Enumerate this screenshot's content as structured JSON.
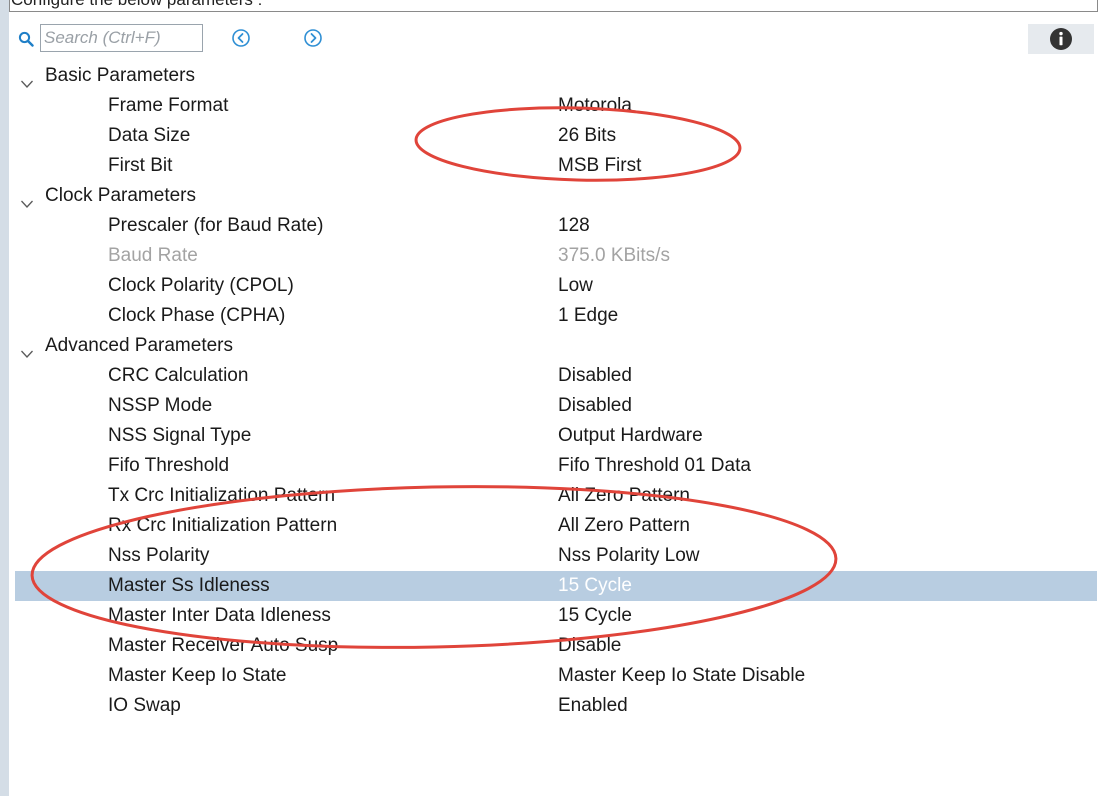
{
  "header": {
    "text": "Configure the below parameters :"
  },
  "toolbar": {
    "search_placeholder": "Search (Ctrl+F)",
    "search_icon": "search-icon",
    "prev_icon": "circle-arrow-left-icon",
    "next_icon": "circle-arrow-right-icon",
    "info_icon": "info-icon"
  },
  "groups": [
    {
      "label": "Basic Parameters",
      "params": [
        {
          "name": "Frame Format",
          "value": "Motorola"
        },
        {
          "name": "Data Size",
          "value": "26 Bits"
        },
        {
          "name": "First Bit",
          "value": "MSB First"
        }
      ]
    },
    {
      "label": "Clock Parameters",
      "params": [
        {
          "name": "Prescaler (for Baud Rate)",
          "value": "128"
        },
        {
          "name": "Baud Rate",
          "value": "375.0 KBits/s"
        },
        {
          "name": "Clock Polarity (CPOL)",
          "value": "Low"
        },
        {
          "name": "Clock Phase (CPHA)",
          "value": "1 Edge"
        }
      ]
    },
    {
      "label": "Advanced Parameters",
      "params": [
        {
          "name": "CRC Calculation",
          "value": "Disabled"
        },
        {
          "name": "NSSP Mode",
          "value": "Disabled"
        },
        {
          "name": "NSS Signal Type",
          "value": "Output Hardware"
        },
        {
          "name": "Fifo Threshold",
          "value": "Fifo Threshold 01 Data"
        },
        {
          "name": "Tx Crc Initialization Pattern",
          "value": "All Zero Pattern"
        },
        {
          "name": "Rx Crc Initialization Pattern",
          "value": "All Zero Pattern"
        },
        {
          "name": "Nss Polarity",
          "value": "Nss Polarity Low"
        },
        {
          "name": "Master Ss Idleness",
          "value": "15 Cycle"
        },
        {
          "name": "Master Inter Data Idleness",
          "value": "15 Cycle"
        },
        {
          "name": "Master Receiver Auto Susp",
          "value": "Disable"
        },
        {
          "name": "Master Keep Io State",
          "value": "Master Keep Io State Disable"
        },
        {
          "name": "IO Swap",
          "value": "Enabled"
        }
      ]
    }
  ],
  "selected_param": "Master Ss Idleness",
  "disabled_params": [
    "Baud Rate"
  ],
  "colors": {
    "selection": "#b8cde1",
    "accent_nav": "#2f8fd4",
    "annotation": "#e0443a",
    "disabled_text": "#a3a3a3"
  }
}
